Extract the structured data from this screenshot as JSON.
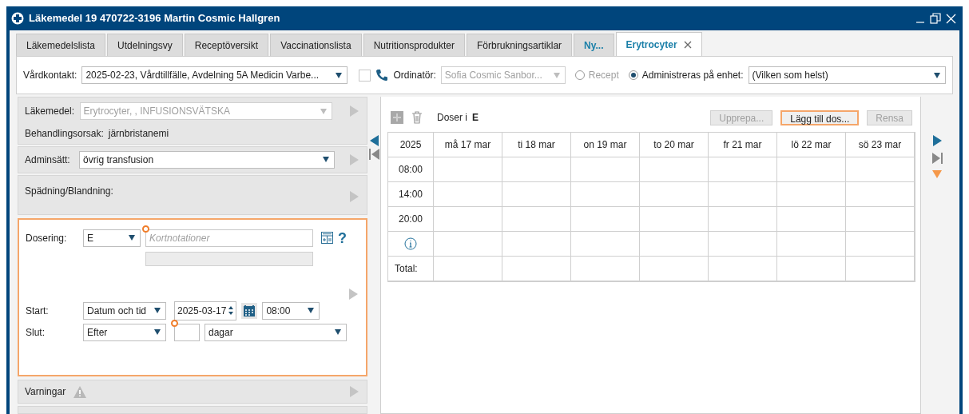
{
  "window": {
    "title": "Läkemedel 19 470722-3196 Martin Cosmic Hallgren"
  },
  "tabs": [
    {
      "label": "Läkemedelslista",
      "selected": false,
      "kind": "normal",
      "closable": false
    },
    {
      "label": "Utdelningsvy",
      "selected": false,
      "kind": "normal",
      "closable": false
    },
    {
      "label": "Receptöversikt",
      "selected": false,
      "kind": "normal",
      "closable": false
    },
    {
      "label": "Vaccinationslista",
      "selected": false,
      "kind": "normal",
      "closable": false
    },
    {
      "label": "Nutritionsprodukter",
      "selected": false,
      "kind": "normal",
      "closable": false
    },
    {
      "label": "Förbrukningsartiklar",
      "selected": false,
      "kind": "normal",
      "closable": false
    },
    {
      "label": "Ny...",
      "selected": false,
      "kind": "new",
      "closable": false
    },
    {
      "label": "Erytrocyter",
      "selected": true,
      "kind": "normal",
      "closable": true
    }
  ],
  "toolbar": {
    "vardkontakt": {
      "label": "Vårdkontakt:",
      "value": "2025-02-23, Vårdtillfälle, Avdelning 5A Medicin Varbe..."
    },
    "checkbox": {
      "checked": false
    },
    "ordinator": {
      "label": "Ordinatör:",
      "value": "Sofia Cosmic Sanbor...",
      "disabled": true
    },
    "radios": [
      {
        "label": "Recept",
        "selected": false,
        "disabled": true
      },
      {
        "label": "Administreras på enhet:",
        "selected": true,
        "disabled": false
      }
    ],
    "enhet": {
      "value": "(Vilken som helst)"
    }
  },
  "form": {
    "lakemedel": {
      "label": "Läkemedel:",
      "value": "Erytrocyter, , INFUSIONSVÄTSKA",
      "disabled": true
    },
    "behandlingsorsak": {
      "label": "Behandlingsorsak:",
      "value": "järnbristanemi"
    },
    "adminsatt": {
      "label": "Adminsätt:",
      "value": "övrig transfusion"
    },
    "spadning": {
      "label": "Spädning/Blandning:"
    },
    "dosering": {
      "label": "Dosering:",
      "unit": "E",
      "placeholder": "Kortnotationer",
      "required": true,
      "help": "?"
    },
    "start": {
      "label": "Start:",
      "type": "Datum och tid",
      "date": "2025-03-17",
      "time": "08:00"
    },
    "slut": {
      "label": "Slut:",
      "type": "Efter",
      "unit": "dagar",
      "required": true
    },
    "varningar": {
      "label": "Varningar"
    }
  },
  "schedule": {
    "doses_label": "Doser i",
    "dose_unit": "E",
    "buttons": [
      {
        "label": "Upprepa...",
        "disabled": true,
        "focused": false
      },
      {
        "label": "Lägg till dos...",
        "disabled": false,
        "focused": true
      },
      {
        "label": "Rensa",
        "disabled": true,
        "focused": false
      }
    ],
    "year": "2025",
    "days": [
      "må 17 mar",
      "ti 18 mar",
      "on 19 mar",
      "to 20 mar",
      "fr 21 mar",
      "lö 22 mar",
      "sö 23 mar"
    ],
    "times": [
      "08:00",
      "14:00",
      "20:00"
    ],
    "total_label": "Total:"
  }
}
